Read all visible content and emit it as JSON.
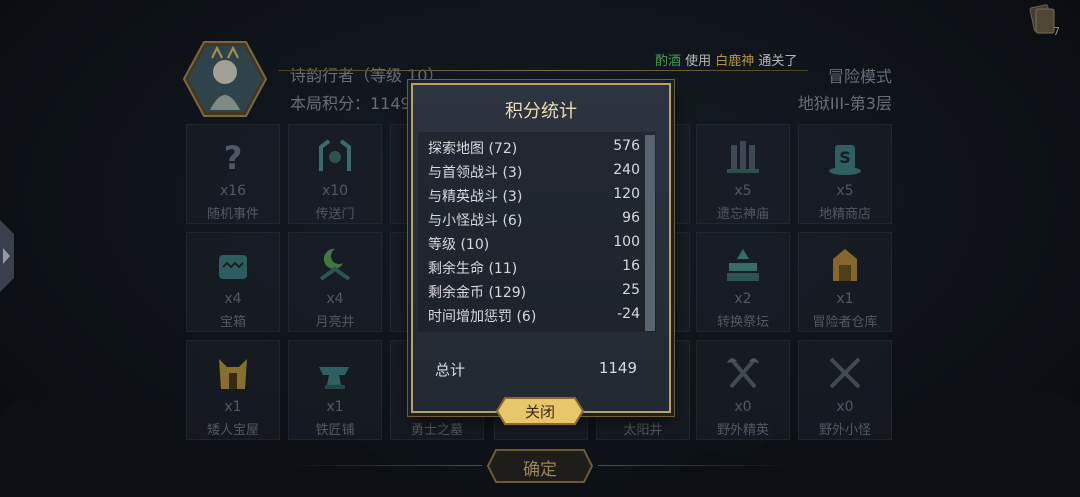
{
  "header": {
    "player_name": "诗韵行者（等级 10）",
    "score_label": "本局积分：1149",
    "mode": "冒险模式",
    "stage": "地狱III-第3层",
    "ticker": {
      "part1": "酌酒",
      "part2": " 使用 ",
      "part3": "白鹿神",
      "part4": " 通关了"
    },
    "card_count": "7"
  },
  "tiles": [
    {
      "icon": "question-mark-icon",
      "count": "x16",
      "name": "随机事件"
    },
    {
      "icon": "portal-icon",
      "count": "x10",
      "name": "传送门"
    },
    {
      "icon": "unknown-icon",
      "count": "",
      "name": ""
    },
    {
      "icon": "unknown-icon",
      "count": "",
      "name": ""
    },
    {
      "icon": "unknown-icon",
      "count": "",
      "name": ""
    },
    {
      "icon": "forgotten-temple-icon",
      "count": "x5",
      "name": "遗忘神庙"
    },
    {
      "icon": "goblin-shop-icon",
      "count": "x5",
      "name": "地精商店"
    },
    {
      "icon": "treasure-chest-icon",
      "count": "x4",
      "name": "宝箱"
    },
    {
      "icon": "moon-well-icon",
      "count": "x4",
      "name": "月亮井"
    },
    {
      "icon": "unknown-icon",
      "count": "",
      "name": ""
    },
    {
      "icon": "unknown-icon",
      "count": "",
      "name": ""
    },
    {
      "icon": "unknown-icon",
      "count": "",
      "name": ""
    },
    {
      "icon": "conversion-altar-icon",
      "count": "x2",
      "name": "转换祭坛"
    },
    {
      "icon": "adventurer-warehouse-icon",
      "count": "x1",
      "name": "冒险者仓库"
    },
    {
      "icon": "dwarf-treasure-icon",
      "count": "x1",
      "name": "矮人宝屋"
    },
    {
      "icon": "anvil-icon",
      "count": "x1",
      "name": "铁匠铺"
    },
    {
      "icon": "warrior-tomb-icon",
      "count": "",
      "name": "勇士之墓"
    },
    {
      "icon": "unknown-icon",
      "count": "",
      "name": ""
    },
    {
      "icon": "sun-well-icon",
      "count": "",
      "name": "太阳井"
    },
    {
      "icon": "axes-icon",
      "count": "x0",
      "name": "野外精英"
    },
    {
      "icon": "swords-icon",
      "count": "x0",
      "name": "野外小怪"
    }
  ],
  "modal": {
    "title": "积分统计",
    "rows": [
      {
        "label": "探索地图 (72)",
        "value": "576"
      },
      {
        "label": "与首领战斗 (3)",
        "value": "240"
      },
      {
        "label": "与精英战斗 (3)",
        "value": "120"
      },
      {
        "label": "与小怪战斗 (6)",
        "value": "96"
      },
      {
        "label": "等级 (10)",
        "value": "100"
      },
      {
        "label": "剩余生命 (11)",
        "value": "16"
      },
      {
        "label": "剩余金币 (129)",
        "value": "25"
      },
      {
        "label": "时间增加惩罚 (6)",
        "value": "-24"
      }
    ],
    "total_label": "总计",
    "total_value": "1149",
    "close_label": "关闭"
  },
  "confirm_label": "确定",
  "colors": {
    "gold": "#b7a06a",
    "accent_green": "#5bd16a",
    "accent_yellow": "#f2c75a"
  }
}
